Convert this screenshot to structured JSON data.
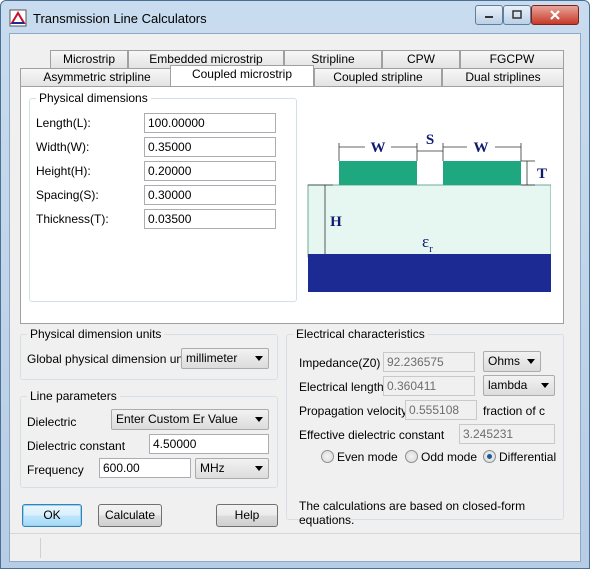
{
  "window": {
    "title": "Transmission Line Calculators"
  },
  "tabs_row1": [
    "Microstrip",
    "Embedded microstrip",
    "Stripline",
    "CPW",
    "FGCPW"
  ],
  "tabs_row2": [
    "Asymmetric stripline",
    "Coupled microstrip",
    "Coupled stripline",
    "Dual striplines"
  ],
  "active_tab": "Coupled microstrip",
  "physical_dimensions": {
    "title": "Physical dimensions",
    "fields": [
      {
        "label": "Length(L):",
        "value": "100.00000"
      },
      {
        "label": "Width(W):",
        "value": "0.35000"
      },
      {
        "label": "Height(H):",
        "value": "0.20000"
      },
      {
        "label": "Spacing(S):",
        "value": "0.30000"
      },
      {
        "label": "Thickness(T):",
        "value": "0.03500"
      }
    ]
  },
  "diagram": {
    "w_left": "W",
    "s": "S",
    "w_right": "W",
    "t": "T",
    "h": "H",
    "er": "ε",
    "er_sub": "r",
    "colors": {
      "conductor": "#1fa77f",
      "substrate": "#e6f7f1",
      "ground": "#1c2b94"
    }
  },
  "units": {
    "title": "Physical dimension units",
    "label": "Global physical dimension units:",
    "value": "millimeter"
  },
  "line_params": {
    "title": "Line parameters",
    "dielectric_label": "Dielectric",
    "dielectric_value": "Enter Custom Er Value",
    "constant_label": "Dielectric constant",
    "constant_value": "4.50000",
    "frequency_label": "Frequency",
    "frequency_value": "600.00",
    "frequency_unit": "MHz"
  },
  "electrical": {
    "title": "Electrical characteristics",
    "impedance_label": "Impedance(Z0)",
    "impedance_value": "92.236575",
    "impedance_unit": "Ohms",
    "length_label": "Electrical length",
    "length_value": "0.360411",
    "length_unit": "lambda",
    "velocity_label": "Propagation velocity",
    "velocity_value": "0.555108",
    "velocity_unit": "fraction of c",
    "eff_label": "Effective dielectric constant",
    "eff_value": "3.245231",
    "modes": [
      "Even mode",
      "Odd mode",
      "Differential"
    ],
    "selected_mode": "Differential",
    "note": "The calculations are based on closed-form equations."
  },
  "buttons": {
    "ok": "OK",
    "calculate": "Calculate",
    "help": "Help"
  }
}
